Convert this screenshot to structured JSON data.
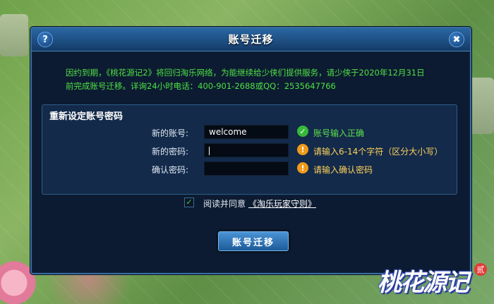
{
  "dialog": {
    "title": "账号迁移",
    "help_icon": "?",
    "close_icon": "✖",
    "notice_line1": "因约到期，《桃花源记2》将回归淘乐网络，为能继续给少侠们提供服务，请少侠于2020年12月31日",
    "notice_line2": "前完成账号迁移。详询24小时电话：400-901-2688或QQ：2535647766"
  },
  "form": {
    "section_title": "重新设定账号密码",
    "account_label": "新的账号:",
    "account_value": "welcome",
    "account_status": "账号输入正确",
    "password_label": "新的密码:",
    "password_value": "",
    "password_status": "请输入6-14个字符（区分大小写）",
    "confirm_label": "确认密码:",
    "confirm_value": "",
    "confirm_status": "请输入确认密码",
    "ok_icon": "✓",
    "warn_icon": "!"
  },
  "agreement": {
    "checked": true,
    "check_glyph": "✓",
    "text": "阅读并同意",
    "link_text": "《淘乐玩家守则》"
  },
  "submit_label": "账号迁移",
  "logo": {
    "text": "桃花源记",
    "badge": "贰"
  }
}
